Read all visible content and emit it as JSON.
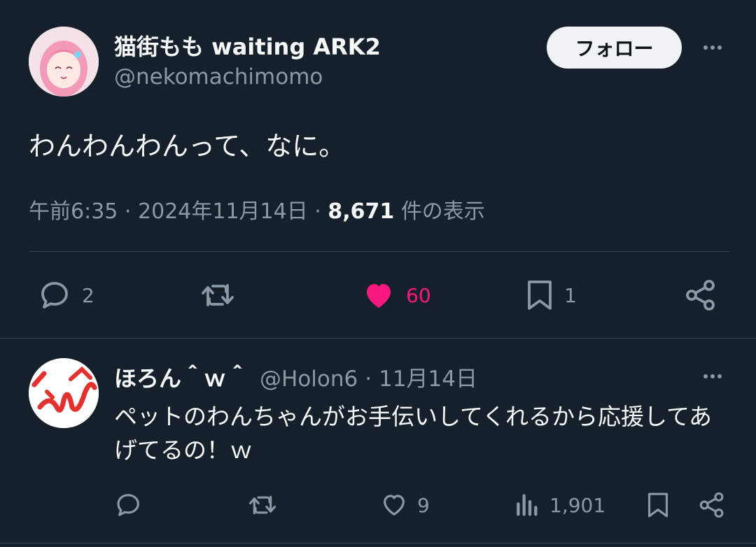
{
  "main_tweet": {
    "display_name": "猫街もも waiting ARK2",
    "handle": "@nekomachimomo",
    "follow_label": "フォロー",
    "text": "わんわんわんって、なに。",
    "time": "午前6:35",
    "separator": "·",
    "date": "2024年11月14日",
    "views_count": "8,671",
    "views_label": "件の表示",
    "actions": {
      "reply_count": "2",
      "like_count": "60",
      "bookmark_count": "1"
    },
    "like_color": "#f91880"
  },
  "reply_tweet": {
    "display_name": "ほろん＾ｗ＾",
    "handle": "@Holon6",
    "separator": "·",
    "date": "11月14日",
    "text": "ペットのわんちゃんがお手伝いしてくれるから応援してあげてるの！ｗ",
    "actions": {
      "like_count": "9",
      "views_count": "1,901"
    }
  },
  "icons": [
    "reply-icon",
    "retweet-icon",
    "heart-icon",
    "bookmark-icon",
    "share-icon",
    "views-icon",
    "more-icon"
  ]
}
